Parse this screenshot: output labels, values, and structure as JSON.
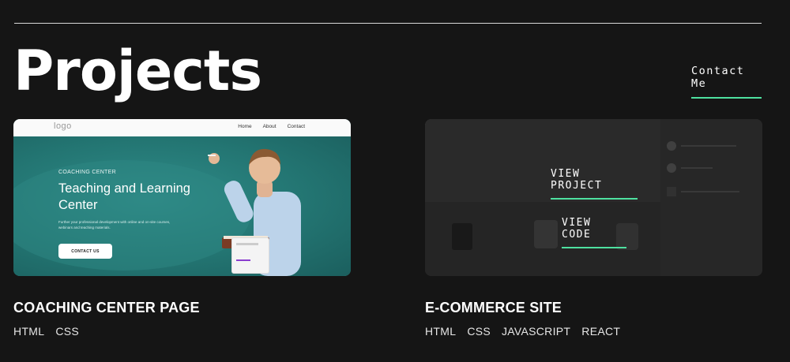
{
  "page": {
    "title": "Projects"
  },
  "header": {
    "contact_label": "Contact Me"
  },
  "projects": [
    {
      "name": "COACHING CENTER PAGE",
      "tags": [
        "HTML",
        "CSS"
      ],
      "preview": {
        "logo": "logo",
        "nav_links": [
          "Home",
          "About",
          "Contact"
        ],
        "kicker": "COACHING CENTER",
        "heading": "Teaching and Learning Center",
        "description": "Further your professional development with online and on-site courses, webinars and teaching materials.",
        "cta": "CONTACT US"
      }
    },
    {
      "name": "E-COMMERCE SITE",
      "tags": [
        "HTML",
        "CSS",
        "JAVASCRIPT",
        "REACT"
      ],
      "overlay": {
        "view_project": "VIEW PROJECT",
        "view_code": "VIEW CODE"
      }
    }
  ],
  "colors": {
    "background": "#151515",
    "accent": "#4ee1a0",
    "text": "#ffffff"
  }
}
